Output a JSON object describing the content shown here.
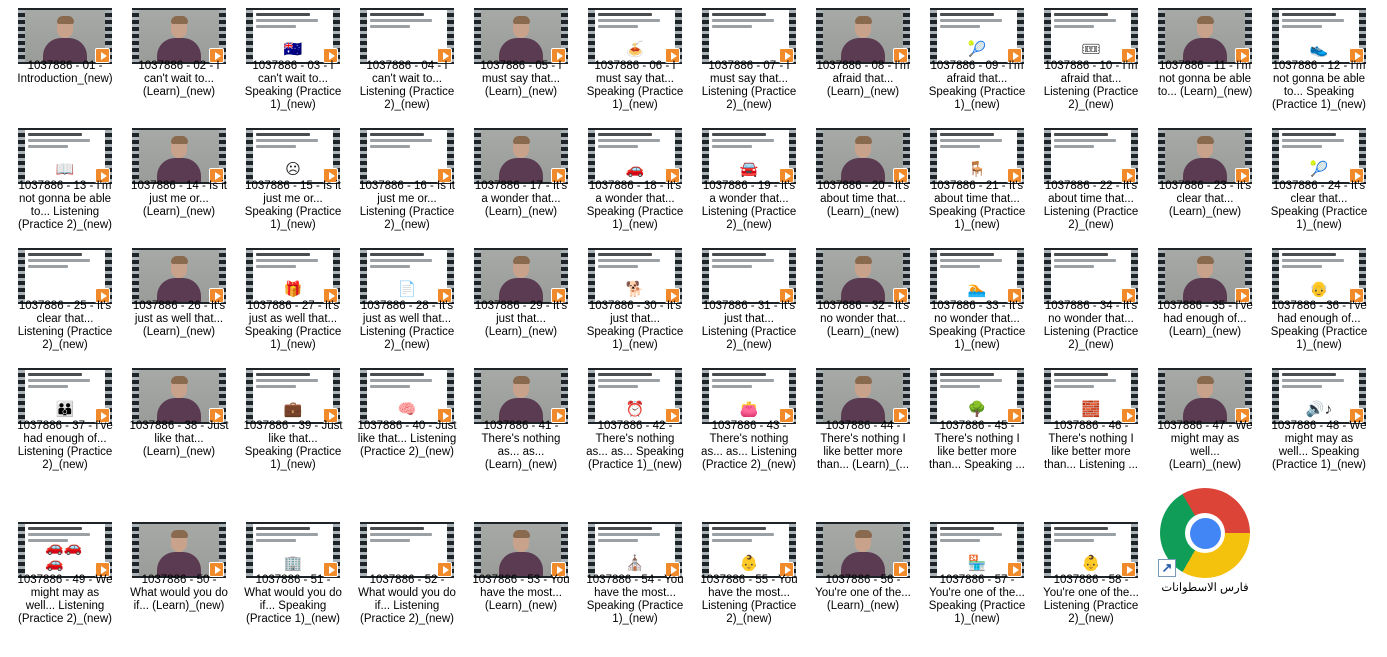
{
  "items": [
    {
      "label": "1037886 - 01 -\nIntroduction_(new)",
      "thumb": "person"
    },
    {
      "label": "1037886 - 02 - I\ncan't wait to...\n(Learn)_(new)",
      "thumb": "person"
    },
    {
      "label": "1037886 - 03 - I\ncan't wait to...\nSpeaking (Practice\n1)_(new)",
      "thumb": "slide",
      "pic": "🇦🇺"
    },
    {
      "label": "1037886 - 04 - I\ncan't wait to...\nListening (Practice\n2)_(new)",
      "thumb": "slide",
      "pic": ""
    },
    {
      "label": "1037886 - 05 - I\nmust say that...\n(Learn)_(new)",
      "thumb": "person"
    },
    {
      "label": "1037886 - 06 - I\nmust say that...\nSpeaking (Practice\n1)_(new)",
      "thumb": "slide",
      "pic": "🍝"
    },
    {
      "label": "1037886 - 07 - I\nmust say that...\nListening (Practice\n2)_(new)",
      "thumb": "slide",
      "pic": ""
    },
    {
      "label": "1037886 - 08 - I'm\nafraid that...\n(Learn)_(new)",
      "thumb": "person"
    },
    {
      "label": "1037886 - 09 - I'm\nafraid that...\nSpeaking (Practice\n1)_(new)",
      "thumb": "slide",
      "pic": "🎾"
    },
    {
      "label": "1037886 - 10 - I'm\nafraid that...\nListening (Practice\n2)_(new)",
      "thumb": "slide",
      "pic": "🎟"
    },
    {
      "label": "1037886 - 11 - I'm\nnot gonna be able\nto... (Learn)_(new)",
      "thumb": "person"
    },
    {
      "label": "1037886 - 12 - I'm\nnot gonna be able\nto... Speaking\n(Practice 1)_(new)",
      "thumb": "slide",
      "pic": "👟"
    },
    {
      "label": "1037886 - 13 - I'm\nnot gonna be able\nto... Listening\n(Practice 2)_(new)",
      "thumb": "slide",
      "pic": "📖"
    },
    {
      "label": "1037886 - 14 - Is it\njust me or...\n(Learn)_(new)",
      "thumb": "person"
    },
    {
      "label": "1037886 - 15 - Is it\njust me or...\nSpeaking (Practice\n1)_(new)",
      "thumb": "slide",
      "pic": "☹"
    },
    {
      "label": "1037886 - 16 - Is it\njust me or...\nListening (Practice\n2)_(new)",
      "thumb": "slide",
      "pic": ""
    },
    {
      "label": "1037886 - 17 - It's\na wonder that...\n(Learn)_(new)",
      "thumb": "person"
    },
    {
      "label": "1037886 - 18 - It's\na wonder that...\nSpeaking (Practice\n1)_(new)",
      "thumb": "slide",
      "pic": "🚗"
    },
    {
      "label": "1037886 - 19 - It's\na wonder that...\nListening (Practice\n2)_(new)",
      "thumb": "slide",
      "pic": "🚘"
    },
    {
      "label": "1037886 - 20 - It's\nabout time that...\n(Learn)_(new)",
      "thumb": "person"
    },
    {
      "label": "1037886 - 21 - It's\nabout time that...\nSpeaking (Practice\n1)_(new)",
      "thumb": "slide",
      "pic": "🪑"
    },
    {
      "label": "1037886 - 22 - It's\nabout time that...\nListening (Practice\n2)_(new)",
      "thumb": "slide",
      "pic": ""
    },
    {
      "label": "1037886 - 23 - It's\nclear that...\n(Learn)_(new)",
      "thumb": "person"
    },
    {
      "label": "1037886 - 24 - It's\nclear that...\nSpeaking (Practice\n1)_(new)",
      "thumb": "slide",
      "pic": "🎾"
    },
    {
      "label": "1037886 - 25 - It's\nclear that...\nListening (Practice\n2)_(new)",
      "thumb": "slide",
      "pic": ""
    },
    {
      "label": "1037886 - 26 - It's\njust as well that...\n(Learn)_(new)",
      "thumb": "person"
    },
    {
      "label": "1037886 - 27 - It's\njust as well that...\nSpeaking (Practice\n1)_(new)",
      "thumb": "slide",
      "pic": "🎁"
    },
    {
      "label": "1037886 - 28 - It's\njust as well that...\nListening (Practice\n2)_(new)",
      "thumb": "slide",
      "pic": "📄"
    },
    {
      "label": "1037886 - 29 - It's\njust that...\n(Learn)_(new)",
      "thumb": "person"
    },
    {
      "label": "1037886 - 30 - It's\njust that...\nSpeaking (Practice\n1)_(new)",
      "thumb": "slide",
      "pic": "🐕"
    },
    {
      "label": "1037886 - 31 - It's\njust that...\nListening (Practice\n2)_(new)",
      "thumb": "slide",
      "pic": ""
    },
    {
      "label": "1037886 - 32 - It's\nno wonder that...\n(Learn)_(new)",
      "thumb": "person"
    },
    {
      "label": "1037886 - 33 - It's\nno wonder that...\nSpeaking (Practice\n1)_(new)",
      "thumb": "slide",
      "pic": "🏊"
    },
    {
      "label": "1037886 - 34 - It's\nno wonder that...\nListening (Practice\n2)_(new)",
      "thumb": "slide",
      "pic": ""
    },
    {
      "label": "1037886 - 35 - I've\nhad enough of...\n(Learn)_(new)",
      "thumb": "person"
    },
    {
      "label": "1037886 - 36 - I've\nhad enough of...\nSpeaking (Practice\n1)_(new)",
      "thumb": "slide",
      "pic": "👴"
    },
    {
      "label": "1037886 - 37 - I've\nhad enough of...\nListening (Practice\n2)_(new)",
      "thumb": "slide",
      "pic": "👪"
    },
    {
      "label": "1037886 - 38 - Just\nlike that...\n(Learn)_(new)",
      "thumb": "person"
    },
    {
      "label": "1037886 - 39 - Just\nlike that...\nSpeaking (Practice\n1)_(new)",
      "thumb": "slide",
      "pic": "💼"
    },
    {
      "label": "1037886 - 40 - Just\nlike that... Listening\n(Practice 2)_(new)",
      "thumb": "slide",
      "pic": "🧠"
    },
    {
      "label": "1037886 - 41 -\nThere's nothing\nas... as...\n(Learn)_(new)",
      "thumb": "person"
    },
    {
      "label": "1037886 - 42 -\nThere's nothing\nas... as... Speaking\n(Practice 1)_(new)",
      "thumb": "slide",
      "pic": "⏰"
    },
    {
      "label": "1037886 - 43 -\nThere's nothing\nas... as... Listening\n(Practice 2)_(new)",
      "thumb": "slide",
      "pic": "👛"
    },
    {
      "label": "1037886 - 44 -\nThere's nothing I\nlike better more\nthan... (Learn)_(...",
      "thumb": "person"
    },
    {
      "label": "1037886 - 45 -\nThere's nothing I\nlike better more\nthan... Speaking ...",
      "thumb": "slide",
      "pic": "🌳"
    },
    {
      "label": "1037886 - 46 -\nThere's nothing I\nlike better more\nthan... Listening ...",
      "thumb": "slide",
      "pic": "🧱"
    },
    {
      "label": "1037886 - 47 - We\nmight may as\nwell...\n(Learn)_(new)",
      "thumb": "person"
    },
    {
      "label": "1037886 - 48 - We\nmight may as\nwell... Speaking\n(Practice 1)_(new)",
      "thumb": "slide",
      "pic": "🔊♪"
    },
    {
      "label": "1037886 - 49 - We\nmight may as\nwell... Listening\n(Practice 2)_(new)",
      "thumb": "slide",
      "pic": "🚗🚗🚗"
    },
    {
      "label": "1037886 - 50 -\nWhat would you do\nif... (Learn)_(new)",
      "thumb": "person"
    },
    {
      "label": "1037886 - 51 -\nWhat would you do\nif... Speaking\n(Practice 1)_(new)",
      "thumb": "slide",
      "pic": "🏢"
    },
    {
      "label": "1037886 - 52 -\nWhat would you do\nif... Listening\n(Practice 2)_(new)",
      "thumb": "slide",
      "pic": ""
    },
    {
      "label": "1037886 - 53 - You\nhave the most...\n(Learn)_(new)",
      "thumb": "person"
    },
    {
      "label": "1037886 - 54 - You\nhave the most...\nSpeaking (Practice\n1)_(new)",
      "thumb": "slide",
      "pic": "⛪"
    },
    {
      "label": "1037886 - 55 - You\nhave the most...\nListening (Practice\n2)_(new)",
      "thumb": "slide",
      "pic": "👶"
    },
    {
      "label": "1037886 - 56 -\nYou're one of the...\n(Learn)_(new)",
      "thumb": "person"
    },
    {
      "label": "1037886 - 57 -\nYou're one of the...\nSpeaking (Practice\n1)_(new)",
      "thumb": "slide",
      "pic": "🏪"
    },
    {
      "label": "1037886 - 58 -\nYou're one of the...\nListening (Practice\n2)_(new)",
      "thumb": "slide",
      "pic": "👶"
    }
  ],
  "shortcut": {
    "label": "فارس الاسطوانات",
    "icon": "chrome-icon",
    "badge": "↗"
  },
  "colors": {
    "play_badge": "#f18a2b",
    "film_strip": "#1d2327"
  }
}
